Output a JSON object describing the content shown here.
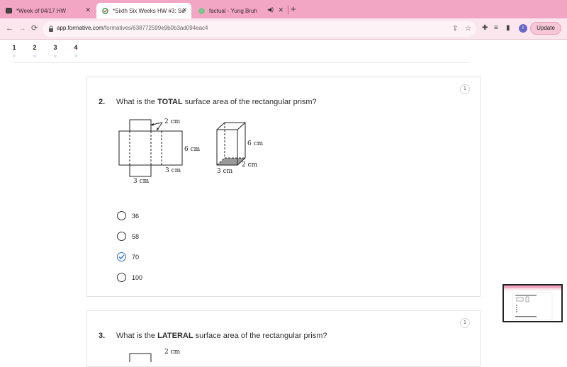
{
  "browser": {
    "tabs": [
      {
        "title": "*Week of 04/17 HW",
        "active": false
      },
      {
        "title": "*Sixth Six Weeks HW #3: Surfa",
        "active": true
      },
      {
        "title": "factual - Yung Bruh",
        "active": false
      }
    ],
    "new_tab_label": "+",
    "url_host": "app.formative.com",
    "url_path": "/formatives/638772599e9b0b3ad094eac4",
    "profile_initial": "I",
    "update_label": "Update"
  },
  "question_nav": [
    "1",
    "2",
    "3",
    "4"
  ],
  "questions": [
    {
      "number": "2.",
      "prefix": "What is the ",
      "emphasis": "TOTAL",
      "suffix": " surface area of the rectangular prism?",
      "points": "1",
      "net_labels": {
        "top": "2 cm",
        "right": "6 cm",
        "bottom_inner": "3 cm",
        "bottom": "3 cm"
      },
      "prism_labels": {
        "height": "6 cm",
        "depth": "2 cm",
        "width": "3 cm"
      },
      "choices": [
        {
          "label": "36",
          "selected": false
        },
        {
          "label": "58",
          "selected": false
        },
        {
          "label": "70",
          "selected": true
        },
        {
          "label": "100",
          "selected": false
        }
      ]
    },
    {
      "number": "3.",
      "prefix": "What is the ",
      "emphasis": "LATERAL",
      "suffix": " surface area of the rectangular prism?",
      "points": "1",
      "net_labels": {
        "top": "2 cm"
      }
    }
  ],
  "colors": {
    "tabstrip": "#f2a6c4",
    "toolbar": "#fbe6ee",
    "accent": "#2f6fc2",
    "profile": "#6a66c8"
  }
}
